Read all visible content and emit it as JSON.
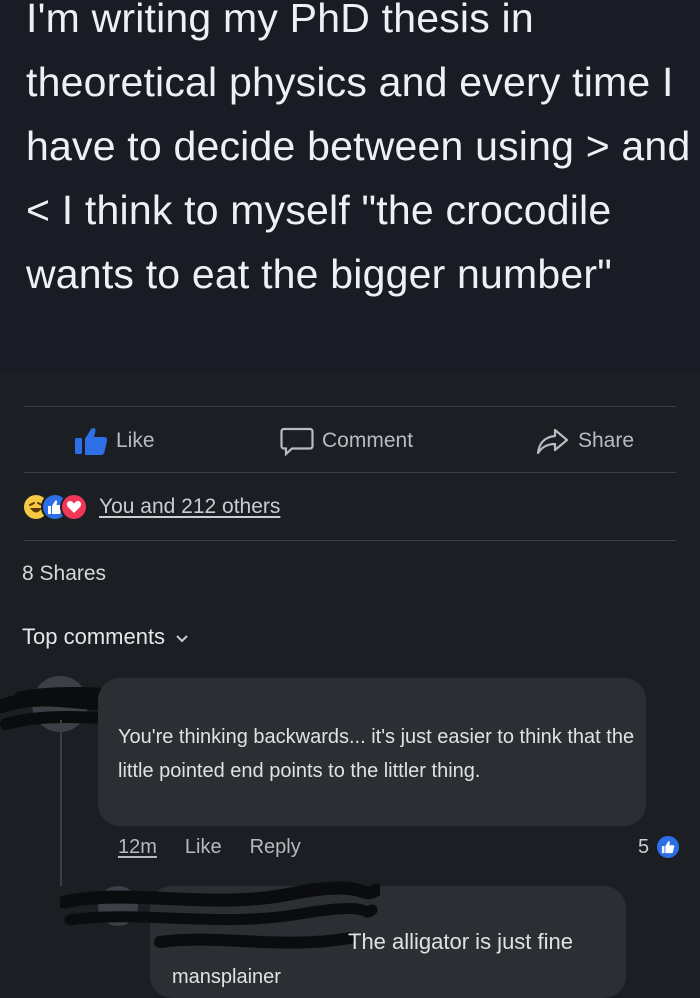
{
  "post": {
    "text": "I'm writing my PhD thesis in theoretical physics and every time I have to decide between using > and < I think to myself \"the crocodile wants to eat the bigger number\""
  },
  "actions": {
    "like_label": "Like",
    "comment_label": "Comment",
    "share_label": "Share"
  },
  "reactions": {
    "icons": [
      "haha-icon",
      "like-icon",
      "love-icon"
    ],
    "summary": "You and 212 others"
  },
  "shares": {
    "label": "8 Shares"
  },
  "comments_header": {
    "label": "Top comments"
  },
  "comments": [
    {
      "text": "You're thinking backwards... it's just easier to think that the little pointed end points to the littler thing.",
      "time": "12m",
      "like_label": "Like",
      "reply_label": "Reply",
      "reaction_count": "5"
    },
    {
      "text": "The alligator is just fine",
      "text_line2": "mansplainer"
    }
  ],
  "colors": {
    "background": "#1b1f23",
    "like_blue": "#2e6fe8",
    "love_red": "#f03756",
    "haha_yellow": "#f7c844",
    "bubble": "#2b2e33"
  }
}
